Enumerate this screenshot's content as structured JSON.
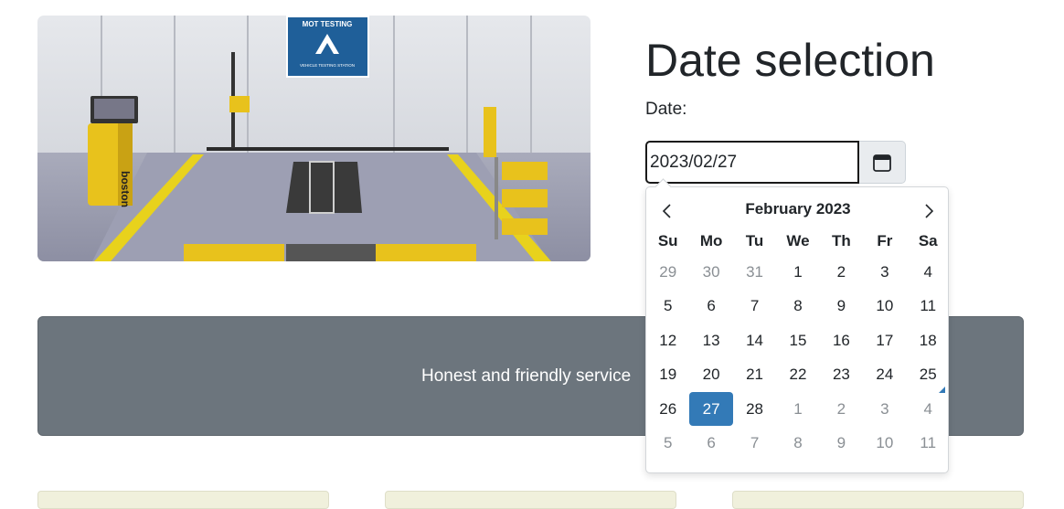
{
  "page": {
    "title": "Date selection",
    "date_label": "Date:",
    "date_value": "2023/02/27",
    "banner_text": "Honest and friendly service"
  },
  "hero": {
    "sign_title": "MOT TESTING",
    "sign_subtitle": "VEHICLE TESTING STATION",
    "brand": "boston"
  },
  "datepicker": {
    "month_label": "February 2023",
    "prev_icon": "chevron-left-icon",
    "next_icon": "chevron-right-icon",
    "weekdays": [
      "Su",
      "Mo",
      "Tu",
      "We",
      "Th",
      "Fr",
      "Sa"
    ],
    "weeks": [
      [
        "29",
        "30",
        "31",
        "1",
        "2",
        "3",
        "4"
      ],
      [
        "5",
        "6",
        "7",
        "8",
        "9",
        "10",
        "11"
      ],
      [
        "12",
        "13",
        "14",
        "15",
        "16",
        "17",
        "18"
      ],
      [
        "19",
        "20",
        "21",
        "22",
        "23",
        "24",
        "25"
      ],
      [
        "26",
        "27",
        "28",
        "1",
        "2",
        "3",
        "4"
      ],
      [
        "5",
        "6",
        "7",
        "8",
        "9",
        "10",
        "11"
      ]
    ],
    "selected_day": "27",
    "selected_color": "#337ab7"
  },
  "colors": {
    "banner": "#6c757d",
    "card": "#f0f0dc"
  }
}
